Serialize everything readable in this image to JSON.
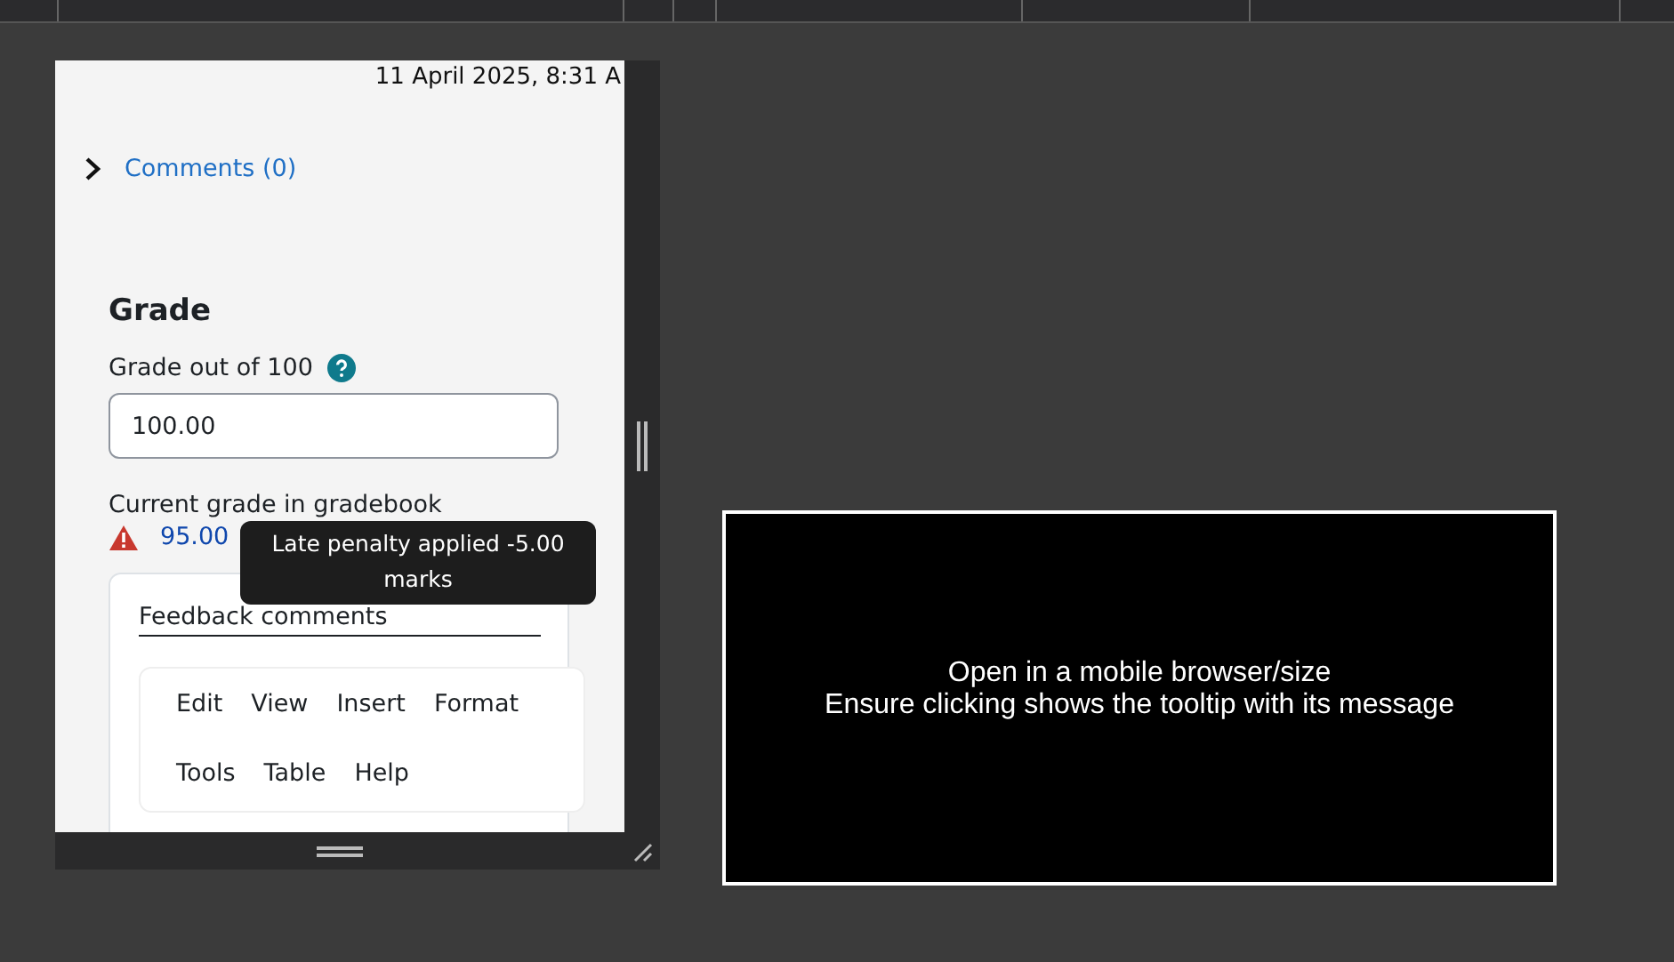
{
  "preview": {
    "timestamp": "11 April 2025, 8:31 A",
    "comments_link": {
      "label": "Comments (0)",
      "expanded": false
    },
    "grade": {
      "heading": "Grade",
      "label": "Grade out of 100",
      "value": "100.00",
      "current_label": "Current grade in gradebook",
      "current_value": "95.00"
    },
    "tooltip": "Late penalty applied -5.00 marks",
    "feedback": {
      "heading": "Feedback comments",
      "menu": [
        "Edit",
        "View",
        "Insert",
        "Format",
        "Tools",
        "Table",
        "Help"
      ]
    }
  },
  "message": [
    "Open in a mobile browser/size",
    "Ensure clicking shows the tooltip with its message"
  ]
}
